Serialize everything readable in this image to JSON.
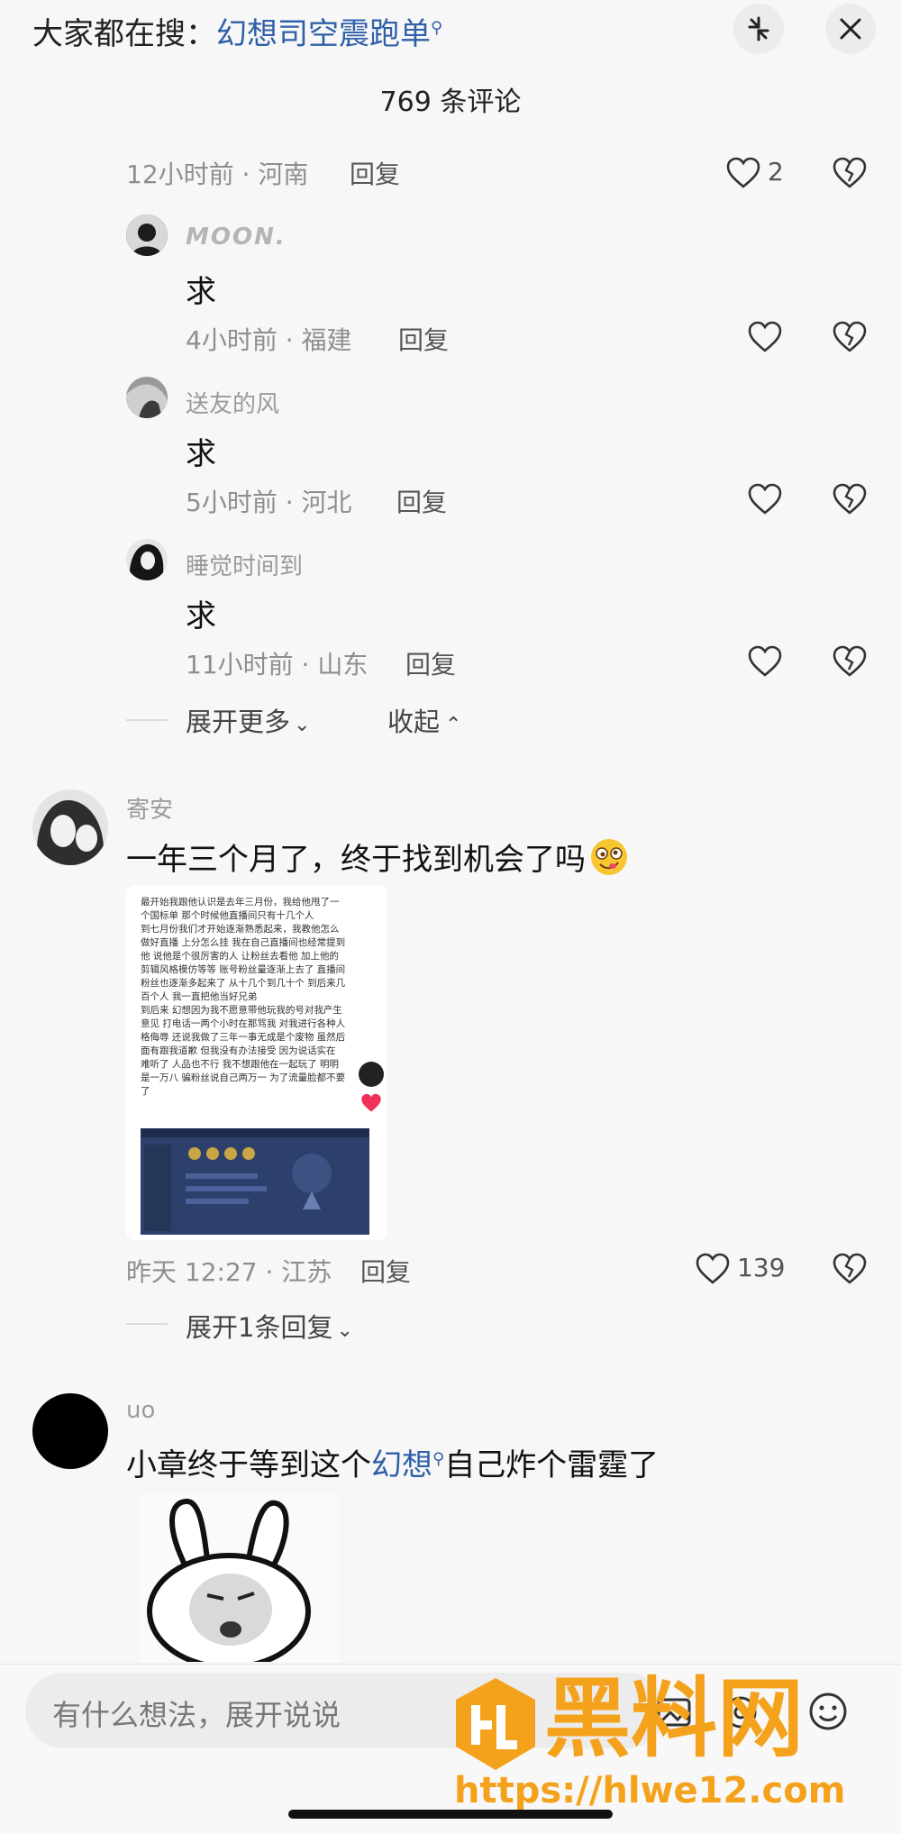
{
  "header": {
    "search_prefix": "大家都在搜：",
    "search_keyword": "幻想司空震跑单",
    "comment_count": "769 条评论"
  },
  "thread1": {
    "parent_meta": "12小时前 · 河南",
    "parent_reply": "回复",
    "parent_likes": "2",
    "replies": [
      {
        "user": "MOON.",
        "text": "求",
        "meta": "4小时前 · 福建",
        "reply": "回复"
      },
      {
        "user": "送友的风",
        "text": "求",
        "meta": "5小时前 · 河北",
        "reply": "回复"
      },
      {
        "user": "睡觉时间到",
        "text": "求",
        "meta": "11小时前 · 山东",
        "reply": "回复"
      }
    ],
    "expand_more": "展开更多",
    "collapse": "收起"
  },
  "comment2": {
    "user": "寄安",
    "text": "一年三个月了，终于找到机会了吗",
    "image_lines": [
      "最开始我跟他认识是去年三月份，我给他甩了一",
      "个国标单 那个时候他直播间只有十几个人",
      "到七月份我们才开始逐渐熟悉起来，我教他怎么",
      "做好直播 上分怎么挂 我在自己直播间也经常提到",
      "他 说他是个很厉害的人 让粉丝去看他 加上他的",
      "剪辑风格模仿等等 账号粉丝量逐渐上去了 直播间",
      "粉丝也逐渐多起来了 从十几个到几十个 到后来几",
      "百个人 我一直把他当好兄弟",
      "到后来 幻想因为我不愿意带他玩我的号对我产生",
      "意见 打电话一两个小时在那骂我 对我进行各种人",
      "格侮辱 还说我做了三年一事无成是个废物 虽然后",
      "面有跟我道歉 但我没有办法接受 因为说话实在",
      "难听了 人品也不行 我不想跟他在一起玩了 明明",
      "是一万八 骗粉丝说自己两万一 为了流量脸都不要",
      "了"
    ],
    "meta": "昨天 12:27 · 江苏",
    "reply": "回复",
    "likes": "139",
    "expand_replies": "展开1条回复"
  },
  "comment3": {
    "user": "uo",
    "text_before": "小章终于等到这个",
    "text_keyword": "幻想",
    "text_after": "自己炸个雷霆了"
  },
  "input": {
    "placeholder": "有什么想法，展开说说"
  },
  "watermark": {
    "title": "黑料网",
    "url": "https://hlwe12.com"
  },
  "colors": {
    "keyword": "#3060a8",
    "watermark": "#f4a21c",
    "background": "#f7f7f7"
  }
}
